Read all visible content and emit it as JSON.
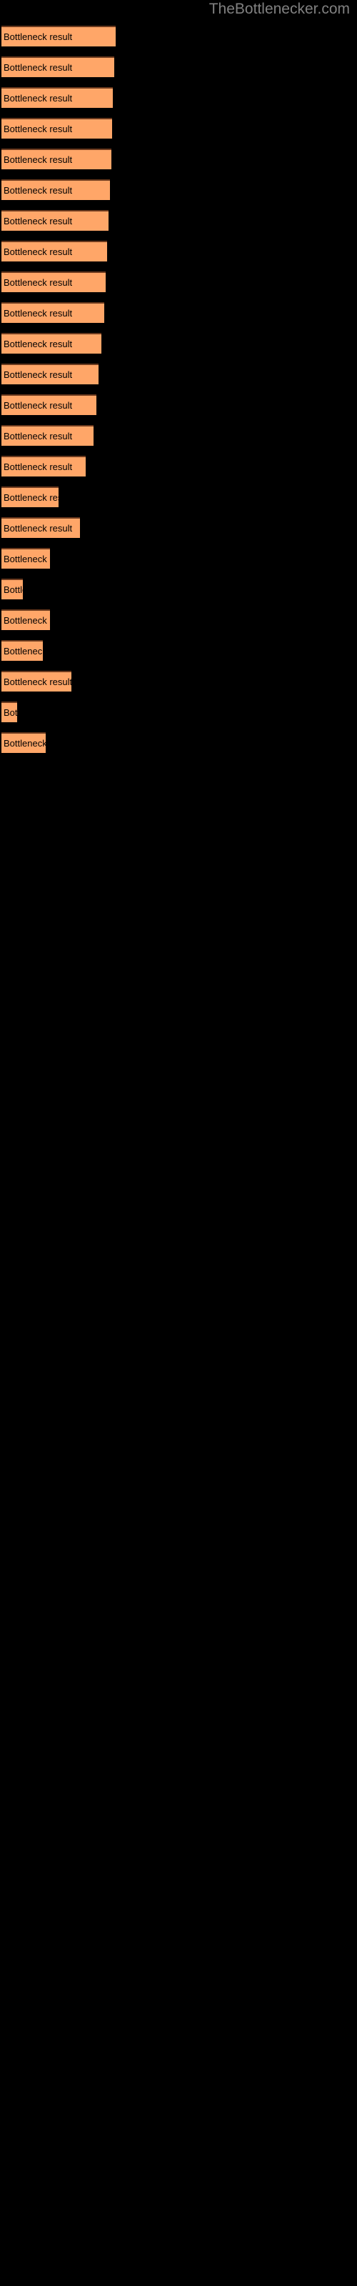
{
  "header": {
    "site_title": "TheBottlenecker.com"
  },
  "theme": {
    "background": "#000000",
    "bar_fill": "#FFA668",
    "bar_border_top": "#6B3A1E",
    "title_color": "#808080",
    "label_color": "#000000"
  },
  "chart_data": {
    "type": "bar",
    "orientation": "horizontal",
    "title": "",
    "subtitle": "",
    "xlabel": "",
    "ylabel": "",
    "grid": false,
    "legend": null,
    "axis_labels_visible": false,
    "bar_label_text": "Bottleneck result",
    "categories": [
      "Bottleneck result",
      "Bottleneck result",
      "Bottleneck result",
      "Bottleneck result",
      "Bottleneck result",
      "Bottleneck result",
      "Bottleneck result",
      "Bottleneck result",
      "Bottleneck result",
      "Bottleneck result",
      "Bottleneck result",
      "Bottleneck result",
      "Bottleneck result",
      "Bottleneck result",
      "Bottleneck result",
      "Bottleneck result",
      "Bottleneck result",
      "Bottleneck result",
      "Bottleneck result",
      "Bottleneck result",
      "Bottleneck result",
      "Bottleneck result",
      "Bottleneck result",
      "Bottleneck result"
    ],
    "values": [
      160,
      158,
      156,
      155,
      154,
      152,
      150,
      148,
      146,
      144,
      140,
      136,
      133,
      129,
      118,
      80,
      110,
      68,
      30,
      68,
      58,
      98,
      22,
      62
    ],
    "value_unit": "px",
    "xlim": [
      0,
      160
    ],
    "bars": [
      {
        "label": "Bottleneck result",
        "width": 160,
        "visible_text": "Bottleneck result"
      },
      {
        "label": "Bottleneck result",
        "width": 158,
        "visible_text": "Bottleneck result"
      },
      {
        "label": "Bottleneck result",
        "width": 156,
        "visible_text": "Bottleneck result"
      },
      {
        "label": "Bottleneck result",
        "width": 155,
        "visible_text": "Bottleneck result"
      },
      {
        "label": "Bottleneck result",
        "width": 154,
        "visible_text": "Bottleneck result"
      },
      {
        "label": "Bottleneck result",
        "width": 152,
        "visible_text": "Bottleneck result"
      },
      {
        "label": "Bottleneck result",
        "width": 150,
        "visible_text": "Bottleneck result"
      },
      {
        "label": "Bottleneck result",
        "width": 148,
        "visible_text": "Bottleneck result"
      },
      {
        "label": "Bottleneck result",
        "width": 146,
        "visible_text": "Bottleneck result"
      },
      {
        "label": "Bottleneck result",
        "width": 144,
        "visible_text": "Bottleneck result"
      },
      {
        "label": "Bottleneck result",
        "width": 140,
        "visible_text": "Bottleneck result"
      },
      {
        "label": "Bottleneck result",
        "width": 136,
        "visible_text": "Bottleneck resul"
      },
      {
        "label": "Bottleneck result",
        "width": 133,
        "visible_text": "Bottleneck resu"
      },
      {
        "label": "Bottleneck result",
        "width": 129,
        "visible_text": "Bottleneck resu"
      },
      {
        "label": "Bottleneck result",
        "width": 118,
        "visible_text": "Bottleneck r"
      },
      {
        "label": "Bottleneck result",
        "width": 80,
        "visible_text": "Bottlen"
      },
      {
        "label": "Bottleneck result",
        "width": 110,
        "visible_text": "Bottleneck"
      },
      {
        "label": "Bottleneck result",
        "width": 68,
        "visible_text": "Bottle"
      },
      {
        "label": "Bottleneck result",
        "width": 30,
        "visible_text": "B"
      },
      {
        "label": "Bottleneck result",
        "width": 68,
        "visible_text": "Bottle"
      },
      {
        "label": "Bottleneck result",
        "width": 58,
        "visible_text": "Bott"
      },
      {
        "label": "Bottleneck result",
        "width": 98,
        "visible_text": "Bottlene"
      },
      {
        "label": "Bottleneck result",
        "width": 22,
        "visible_text": "B"
      },
      {
        "label": "Bottleneck result",
        "width": 62,
        "visible_text": "Bottl"
      }
    ]
  }
}
